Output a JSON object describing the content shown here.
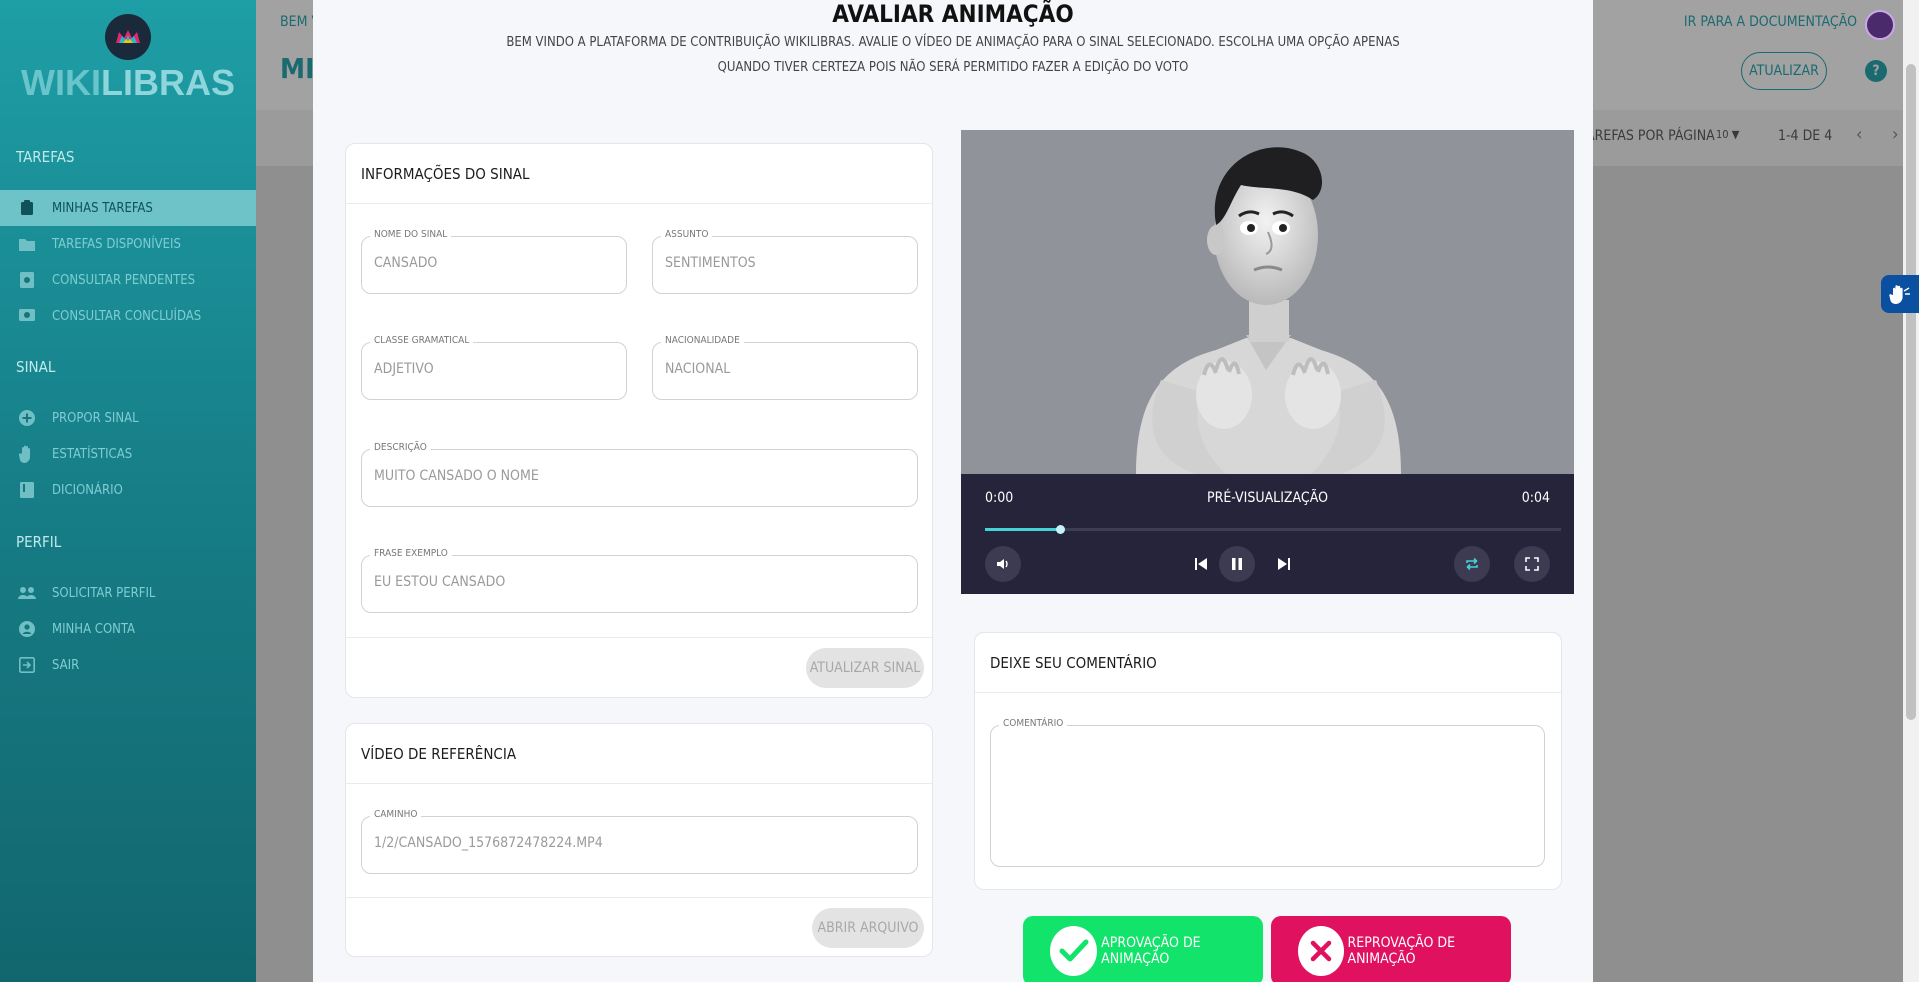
{
  "sidebar": {
    "logo_text_1": "WIKI",
    "logo_text_2": "LIBRAS",
    "sections": [
      {
        "title": "Tarefas",
        "items": [
          {
            "label": "Minhas Tarefas",
            "icon": "clipboard-icon",
            "active": true
          },
          {
            "label": "Tarefas Disponíveis",
            "icon": "folder-plus-icon"
          },
          {
            "label": "Consultar Pendentes",
            "icon": "search-doc-icon"
          },
          {
            "label": "Consultar Concluídas",
            "icon": "search-screen-icon"
          }
        ]
      },
      {
        "title": "Sinal",
        "items": [
          {
            "label": "Propor Sinal",
            "icon": "plus-circle-icon"
          },
          {
            "label": "Estatísticas",
            "icon": "hand-icon"
          },
          {
            "label": "Dicionário",
            "icon": "book-icon"
          }
        ]
      },
      {
        "title": "Perfil",
        "items": [
          {
            "label": "Solicitar Perfil",
            "icon": "people-icon"
          },
          {
            "label": "Minha Conta",
            "icon": "account-icon"
          },
          {
            "label": "Sair",
            "icon": "logout-icon"
          }
        ]
      }
    ]
  },
  "background": {
    "welcome": "Bem vi",
    "title": "Min",
    "doc_link": "Ir para a documentação",
    "update_button": "Atualizar",
    "help": "?",
    "per_page_label": "arefas por página",
    "per_page_value": "10",
    "range": "1-4 de 4"
  },
  "modal": {
    "title": "Avaliar Animação",
    "subtitle": "Bem vindo a plataforma de contribuição Wikilibras. Avalie o vídeo de animação para o sinal selecionado. Escolha uma opção apenas quando tiver certeza pois não será permitido fazer a edição do voto",
    "sign_info": {
      "header": "Informações do Sinal",
      "fields": {
        "name": {
          "label": "Nome do sinal",
          "value": "CANSADO"
        },
        "subject": {
          "label": "Assunto",
          "value": "SENTIMENTOS"
        },
        "class": {
          "label": "Classe gramatical",
          "value": "ADJETIVO"
        },
        "nationality": {
          "label": "Nacionalidade",
          "value": "NACIONAL"
        },
        "description": {
          "label": "Descrição",
          "value": "MUITO CANSADO O NOME"
        },
        "example": {
          "label": "Frase exemplo",
          "value": "EU ESTOU CANSADO"
        }
      },
      "update_button": "Atualizar Sinal"
    },
    "reference_video": {
      "header": "Vídeo de referência",
      "path_label": "Caminho",
      "path_value": "1/2/CANSADO_1576872478224.mp4",
      "open_button": "Abrir arquivo"
    },
    "player": {
      "current_time": "0:00",
      "mode_label": "Pré-visualização",
      "duration": "0:04",
      "progress_fraction": 0.13
    },
    "comment": {
      "header": "Deixe seu comentário",
      "label": "Comentário",
      "value": ""
    },
    "approve_button": "Aprovação de animação",
    "reject_button": "Reprovação de animação"
  }
}
